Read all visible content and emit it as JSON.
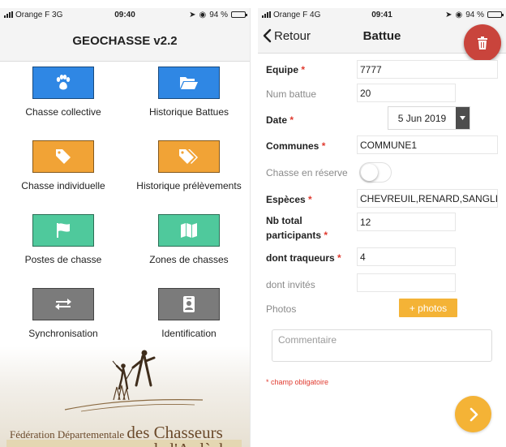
{
  "left_phone": {
    "status": {
      "carrier": "Orange F  3G",
      "time": "09:40",
      "battery": "94 %",
      "battery_level": 0.94
    },
    "header": {
      "title": "GEOCHASSE v2.2"
    },
    "menu": [
      {
        "label": "Chasse collective",
        "icon": "paw-icon",
        "color": "#2f87e4"
      },
      {
        "label": "Historique Battues",
        "icon": "folder-open-icon",
        "color": "#2f87e4"
      },
      {
        "label": "Chasse individuelle",
        "icon": "tag-icon",
        "color": "#f1a336"
      },
      {
        "label": "Historique prélèvements",
        "icon": "tags-icon",
        "color": "#f1a336"
      },
      {
        "label": "Postes de chasse",
        "icon": "flag-icon",
        "color": "#4fc99c"
      },
      {
        "label": "Zones de chasses",
        "icon": "map-icon",
        "color": "#4fc99c"
      },
      {
        "label": "Synchronisation",
        "icon": "exchange-icon",
        "color": "#7b7b7b"
      },
      {
        "label": "Identification",
        "icon": "id-badge-icon",
        "color": "#7b7b7b"
      }
    ],
    "logo": {
      "line1_small": "Fédération Départementale",
      "line1_big": "des Chasseurs",
      "line2": "de l'Ardèche"
    }
  },
  "right_phone": {
    "status": {
      "carrier": "Orange F  4G",
      "time": "09:41",
      "battery": "94 %",
      "battery_level": 0.94
    },
    "header": {
      "back_label": "Retour",
      "title": "Battue"
    },
    "form": {
      "equipe": {
        "label": "Equipe",
        "value": "7777"
      },
      "num_battue": {
        "label": "Num battue",
        "value": "20"
      },
      "date": {
        "label": "Date",
        "value": "5 Jun 2019"
      },
      "communes": {
        "label": "Communes",
        "value": "COMMUNE1"
      },
      "chasse_reserve": {
        "label": "Chasse en réserve",
        "on": false
      },
      "especes": {
        "label": "Espèces",
        "value": "CHEVREUIL,RENARD,SANGLIER"
      },
      "nb_participants": {
        "label_line1": "Nb total",
        "label_line2": "participants",
        "value": "12"
      },
      "traqueurs": {
        "label": "dont traqueurs",
        "value": "4"
      },
      "invites": {
        "label": "dont invités",
        "value": ""
      },
      "photos": {
        "label": "Photos",
        "button": "+ photos"
      },
      "comment": {
        "placeholder": "Commentaire"
      },
      "required_note": "* champ obligatoire",
      "required_mark": "*"
    }
  },
  "colors": {
    "accent_red": "#c9443c",
    "accent_yellow": "#f4b336",
    "required": "#e03a2f"
  }
}
